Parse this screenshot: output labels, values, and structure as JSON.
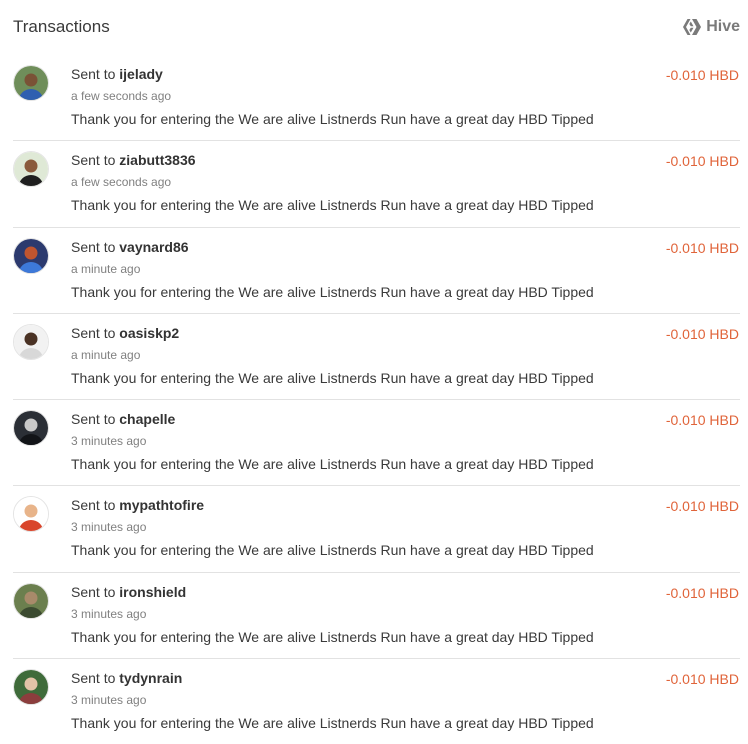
{
  "header": {
    "title": "Transactions",
    "network_label": "Hive",
    "network_icon": "hive-logo-icon"
  },
  "colors": {
    "amount": "#e0643a",
    "muted": "#808080",
    "divider": "#e2e2e2"
  },
  "transactions": [
    {
      "prefix": "Sent to",
      "user": "ijelady",
      "time": "a few seconds ago",
      "memo": "Thank you for entering the We are alive Listnerds Run have a great day HBD Tipped",
      "amount": "-0.010 HBD",
      "avatar": {
        "bg": "#6f8e5a",
        "fg": "#2f5fb0",
        "skin": "#7a5236"
      }
    },
    {
      "prefix": "Sent to",
      "user": "ziabutt3836",
      "time": "a few seconds ago",
      "memo": "Thank you for entering the We are alive Listnerds Run have a great day HBD Tipped",
      "amount": "-0.010 HBD",
      "avatar": {
        "bg": "#dfe9d6",
        "fg": "#1f1f1f",
        "skin": "#8a5a3c"
      }
    },
    {
      "prefix": "Sent to",
      "user": "vaynard86",
      "time": "a minute ago",
      "memo": "Thank you for entering the We are alive Listnerds Run have a great day HBD Tipped",
      "amount": "-0.010 HBD",
      "avatar": {
        "bg": "#2c3a6e",
        "fg": "#3d79d9",
        "skin": "#c0552f"
      }
    },
    {
      "prefix": "Sent to",
      "user": "oasiskp2",
      "time": "a minute ago",
      "memo": "Thank you for entering the We are alive Listnerds Run have a great day HBD Tipped",
      "amount": "-0.010 HBD",
      "avatar": {
        "bg": "#f2f2f2",
        "fg": "#d8d8d8",
        "skin": "#4a3224"
      }
    },
    {
      "prefix": "Sent to",
      "user": "chapelle",
      "time": "3 minutes ago",
      "memo": "Thank you for entering the We are alive Listnerds Run have a great day HBD Tipped",
      "amount": "-0.010 HBD",
      "avatar": {
        "bg": "#2b2f36",
        "fg": "#121418",
        "skin": "#c9c9c9"
      }
    },
    {
      "prefix": "Sent to",
      "user": "mypathtofire",
      "time": "3 minutes ago",
      "memo": "Thank you for entering the We are alive Listnerds Run have a great day HBD Tipped",
      "amount": "-0.010 HBD",
      "avatar": {
        "bg": "#ffffff",
        "fg": "#d9452b",
        "skin": "#e8b48a"
      }
    },
    {
      "prefix": "Sent to",
      "user": "ironshield",
      "time": "3 minutes ago",
      "memo": "Thank you for entering the We are alive Listnerds Run have a great day HBD Tipped",
      "amount": "-0.010 HBD",
      "avatar": {
        "bg": "#6b7f4e",
        "fg": "#3b4a30",
        "skin": "#a88a6a"
      }
    },
    {
      "prefix": "Sent to",
      "user": "tydynrain",
      "time": "3 minutes ago",
      "memo": "Thank you for entering the We are alive Listnerds Run have a great day HBD Tipped",
      "amount": "-0.010 HBD",
      "avatar": {
        "bg": "#3f6b3a",
        "fg": "#8c3d3d",
        "skin": "#e3c3a7"
      }
    }
  ]
}
